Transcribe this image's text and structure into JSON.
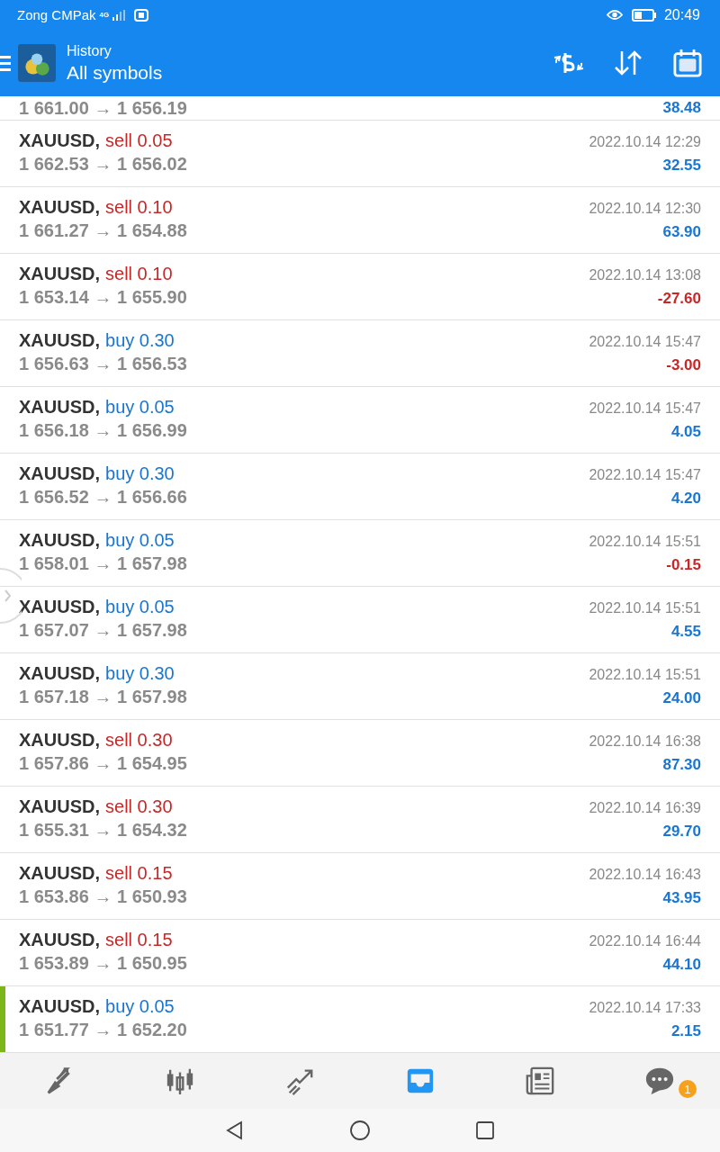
{
  "status_bar": {
    "carrier": "Zong CMPak",
    "network": "4G",
    "time": "20:49"
  },
  "header": {
    "title": "History",
    "subtitle": "All symbols"
  },
  "partial_row": {
    "prices": "1 661.00 → 1 656.19",
    "profit": "38.48",
    "kind": "gain"
  },
  "deals": [
    {
      "symbol": "XAUUSD,",
      "action": "sell",
      "volume": "0.05",
      "prices": "1 662.53 → 1 656.02",
      "time": "2022.10.14 12:29",
      "profit": "32.55",
      "kind": "gain",
      "selected": false
    },
    {
      "symbol": "XAUUSD,",
      "action": "sell",
      "volume": "0.10",
      "prices": "1 661.27 → 1 654.88",
      "time": "2022.10.14 12:30",
      "profit": "63.90",
      "kind": "gain",
      "selected": false
    },
    {
      "symbol": "XAUUSD,",
      "action": "sell",
      "volume": "0.10",
      "prices": "1 653.14 → 1 655.90",
      "time": "2022.10.14 13:08",
      "profit": "-27.60",
      "kind": "loss",
      "selected": false
    },
    {
      "symbol": "XAUUSD,",
      "action": "buy",
      "volume": "0.30",
      "prices": "1 656.63 → 1 656.53",
      "time": "2022.10.14 15:47",
      "profit": "-3.00",
      "kind": "loss",
      "selected": false
    },
    {
      "symbol": "XAUUSD,",
      "action": "buy",
      "volume": "0.05",
      "prices": "1 656.18 → 1 656.99",
      "time": "2022.10.14 15:47",
      "profit": "4.05",
      "kind": "gain",
      "selected": false
    },
    {
      "symbol": "XAUUSD,",
      "action": "buy",
      "volume": "0.30",
      "prices": "1 656.52 → 1 656.66",
      "time": "2022.10.14 15:47",
      "profit": "4.20",
      "kind": "gain",
      "selected": false
    },
    {
      "symbol": "XAUUSD,",
      "action": "buy",
      "volume": "0.05",
      "prices": "1 658.01 → 1 657.98",
      "time": "2022.10.14 15:51",
      "profit": "-0.15",
      "kind": "loss",
      "selected": false
    },
    {
      "symbol": "XAUUSD,",
      "action": "buy",
      "volume": "0.05",
      "prices": "1 657.07 → 1 657.98",
      "time": "2022.10.14 15:51",
      "profit": "4.55",
      "kind": "gain",
      "selected": false
    },
    {
      "symbol": "XAUUSD,",
      "action": "buy",
      "volume": "0.30",
      "prices": "1 657.18 → 1 657.98",
      "time": "2022.10.14 15:51",
      "profit": "24.00",
      "kind": "gain",
      "selected": false
    },
    {
      "symbol": "XAUUSD,",
      "action": "sell",
      "volume": "0.30",
      "prices": "1 657.86 → 1 654.95",
      "time": "2022.10.14 16:38",
      "profit": "87.30",
      "kind": "gain",
      "selected": false
    },
    {
      "symbol": "XAUUSD,",
      "action": "sell",
      "volume": "0.30",
      "prices": "1 655.31 → 1 654.32",
      "time": "2022.10.14 16:39",
      "profit": "29.70",
      "kind": "gain",
      "selected": false
    },
    {
      "symbol": "XAUUSD,",
      "action": "sell",
      "volume": "0.15",
      "prices": "1 653.86 → 1 650.93",
      "time": "2022.10.14 16:43",
      "profit": "43.95",
      "kind": "gain",
      "selected": false
    },
    {
      "symbol": "XAUUSD,",
      "action": "sell",
      "volume": "0.15",
      "prices": "1 653.89 → 1 650.95",
      "time": "2022.10.14 16:44",
      "profit": "44.10",
      "kind": "gain",
      "selected": false
    },
    {
      "symbol": "XAUUSD,",
      "action": "buy",
      "volume": "0.05",
      "prices": "1 651.77 → 1 652.20",
      "time": "2022.10.14 17:33",
      "profit": "2.15",
      "kind": "gain",
      "selected": true
    }
  ],
  "bottom_nav": [
    {
      "kind": "quotes",
      "selected": false
    },
    {
      "kind": "chart",
      "selected": false
    },
    {
      "kind": "trade",
      "selected": false
    },
    {
      "kind": "history",
      "selected": true
    },
    {
      "kind": "news",
      "selected": false
    },
    {
      "kind": "chat",
      "selected": false,
      "badge": "1"
    }
  ]
}
